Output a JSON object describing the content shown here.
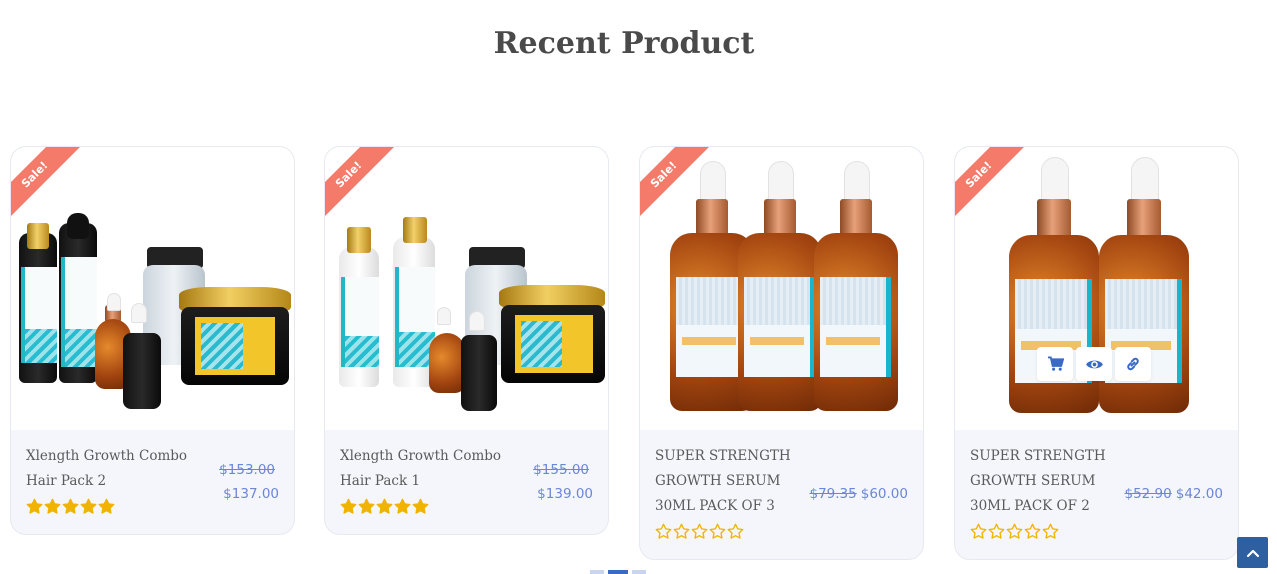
{
  "section": {
    "title": "Recent Product"
  },
  "badge_label": "Sale!",
  "products": [
    {
      "name_lines": [
        "Xlength Growth Combo",
        "Hair Pack 2"
      ],
      "old_price": "$153.00",
      "price": "$137.00",
      "rating": 5
    },
    {
      "name_lines": [
        "Xlength Growth Combo",
        "Hair Pack 1"
      ],
      "old_price": "$155.00",
      "price": "$139.00",
      "rating": 5
    },
    {
      "name_lines": [
        "SUPER STRENGTH",
        "GROWTH SERUM",
        "30ML PACK OF 3"
      ],
      "old_price": "$79.35",
      "price": "$60.00",
      "rating": 0
    },
    {
      "name_lines": [
        "SUPER STRENGTH",
        "GROWTH SERUM",
        "30ML PACK OF 2"
      ],
      "old_price": "$52.90",
      "price": "$42.00",
      "rating": 0
    }
  ],
  "hover_actions": [
    "cart-icon",
    "eye-icon",
    "link-icon"
  ],
  "colors": {
    "sale_ribbon": "#f47a6a",
    "price": "#6c86d8",
    "star": "#f0b400",
    "accent": "#2e5fa0",
    "card_bg": "#f4f6fb"
  }
}
